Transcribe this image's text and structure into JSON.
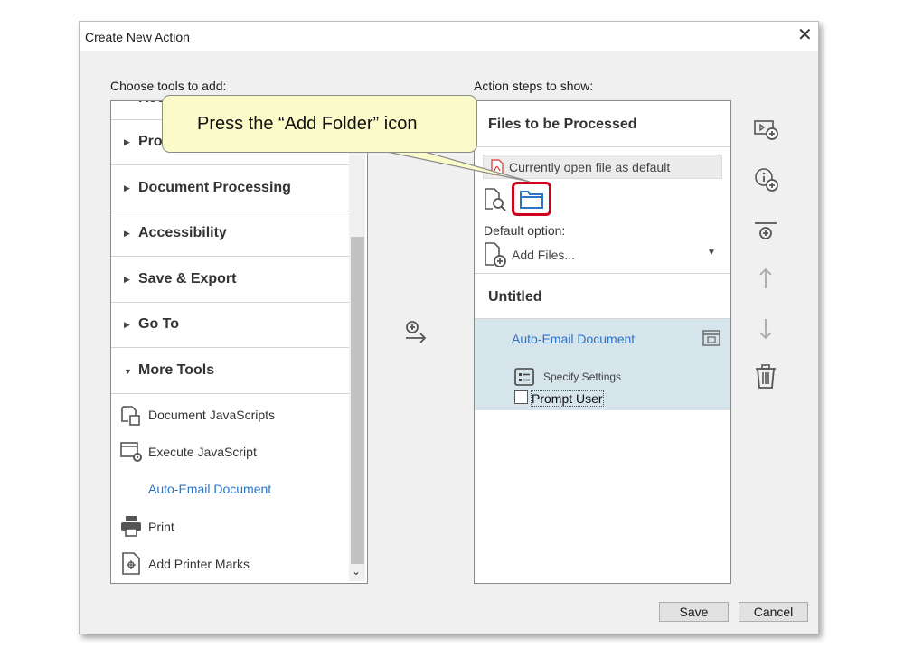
{
  "dialog": {
    "title": "Create New Action",
    "close_symbol": "✕",
    "left_label": "Choose tools to add:",
    "right_label": "Action steps to show:"
  },
  "categories": [
    {
      "label": "Protect & Standardize",
      "expanded": false
    },
    {
      "label": "Document Processing",
      "expanded": false
    },
    {
      "label": "Accessibility",
      "expanded": false
    },
    {
      "label": "Save & Export",
      "expanded": false
    },
    {
      "label": "Go To",
      "expanded": false
    },
    {
      "label": "More Tools",
      "expanded": true
    }
  ],
  "tools": [
    {
      "label": "Document JavaScripts",
      "icon": "document-javascript-icon"
    },
    {
      "label": "Execute JavaScript",
      "icon": "execute-javascript-icon"
    },
    {
      "label": "Auto-Email Document",
      "icon": "none"
    },
    {
      "label": "Print",
      "icon": "printer-icon"
    },
    {
      "label": "Add Printer Marks",
      "icon": "printer-marks-icon"
    }
  ],
  "callout": {
    "text": "Press the “Add Folder” icon"
  },
  "right": {
    "files_heading": "Files to be Processed",
    "current_file_label": "Currently open file as default",
    "default_option_label": "Default option:",
    "default_option_value": "Add Files...",
    "untitled_heading": "Untitled",
    "step_title": "Auto-Email Document",
    "specify_settings_label": "Specify Settings",
    "prompt_user_label": "Prompt User",
    "prompt_user_checked": false
  },
  "buttons": {
    "save": "Save",
    "cancel": "Cancel"
  },
  "colors": {
    "accent_blue": "#2d74c4",
    "selected_step_bg": "#d6e4ec",
    "highlight_red": "#d0021b",
    "callout_fill": "#fbfbc9"
  }
}
